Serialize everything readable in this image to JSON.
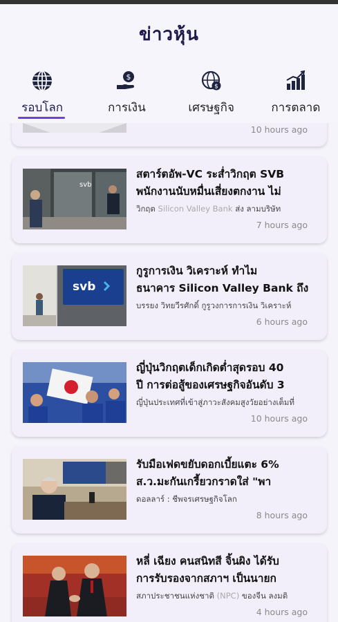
{
  "app": {
    "title": "ข่าวหุ้น"
  },
  "tabs": [
    {
      "label": "รอบโลก",
      "icon": "globe-icon",
      "active": true
    },
    {
      "label": "การเงิน",
      "icon": "money-hand-icon",
      "active": false
    },
    {
      "label": "เศรษฐกิจ",
      "icon": "global-economy-icon",
      "active": false
    },
    {
      "label": "การตลาด",
      "icon": "bar-chart-icon",
      "active": false
    }
  ],
  "articles": [
    {
      "title_1": "",
      "title_2": "",
      "desc": "",
      "time": "10 hours ago"
    },
    {
      "title_1": "สตาร์ตอัพ-VC ระส่ำวิกฤต SVB",
      "title_2": "พนักงานนับหมื่นเสี่ยงตกงาน ไม่",
      "desc_a": "วิกฤต ",
      "desc_link": "Silicon Valley Bank",
      "desc_b": " ส่ง ลามบริษัท",
      "time": "7 hours ago"
    },
    {
      "title_1": "กูรูการเงิน วิเคราะห์ ทำไม",
      "title_2": "ธนาคาร Silicon Valley Bank ถึง",
      "desc_a": "บรรยง วิทยวีรศักดิ์ กูรูวงการการเงิน วิเคราะห์",
      "desc_link": "",
      "desc_b": "",
      "time": "6 hours ago"
    },
    {
      "title_1": "ญี่ปุ่นวิกฤตเด็กเกิดต่ำสุดรอบ 40",
      "title_2": "ปี การต่อสู้ของเศรษฐกิจอันดับ 3",
      "desc_a": "ญี่ปุ่นประเทศที่เข้าสู่ภาวะสังคมสูงวัยอย่างเต็มที่",
      "desc_link": "",
      "desc_b": "",
      "time": "10 hours ago"
    },
    {
      "title_1": "รับมือเฟดขยับดอกเบี้ยแตะ 6%",
      "title_2": "ส.ว.มะกันเกรี้ยวกราดใส่ \"พา",
      "desc_a": "ดอลลาร์  :  ชีพจรเศรษฐกิจโลก",
      "desc_link": "",
      "desc_b": "",
      "time": "8 hours ago"
    },
    {
      "title_1": "หลี่ เฉียง คนสนิทสี จิ้นผิง ได้รับ",
      "title_2": "การรับรองจากสภาฯ เป็นนายก",
      "desc_a": "สภาประชาชนแห่งชาติ ",
      "desc_link": "(NPC)",
      "desc_b": " ของจีน ลงมติ",
      "time": "4 hours ago"
    }
  ],
  "colors": {
    "accent": "#6d3fe6",
    "title": "#1e1b4b",
    "card": "#f2effa"
  }
}
